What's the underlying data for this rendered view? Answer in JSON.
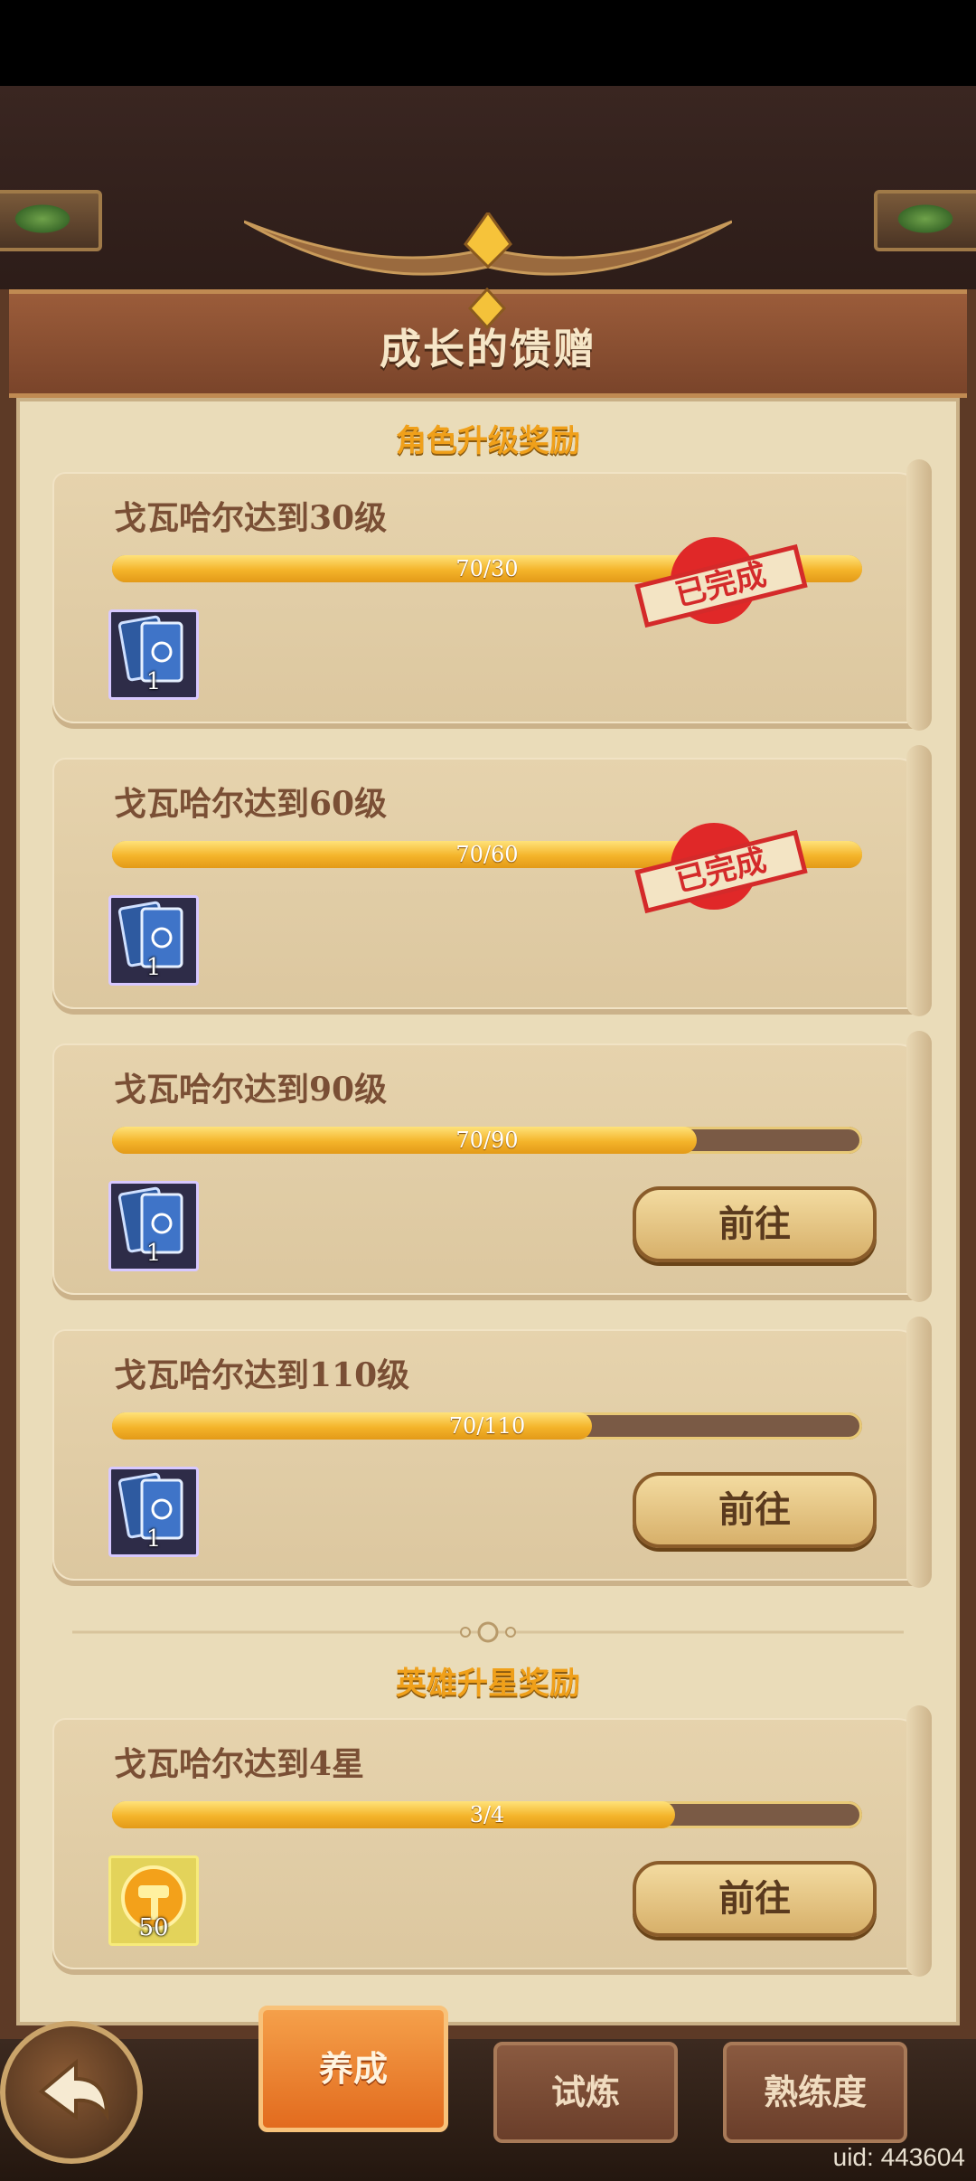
{
  "header": {
    "title": "成长的馈赠"
  },
  "sections": [
    {
      "title": "角色升级奖励",
      "tasks": [
        {
          "label": "戈瓦哈尔达到30级",
          "progress_text": "70/30",
          "progress": 1.0,
          "reward": {
            "icon": "card-pack-icon",
            "qty": "1"
          },
          "status": "已完成"
        },
        {
          "label": "戈瓦哈尔达到60级",
          "progress_text": "70/60",
          "progress": 1.0,
          "reward": {
            "icon": "card-pack-icon",
            "qty": "1"
          },
          "status": "已完成"
        },
        {
          "label": "戈瓦哈尔达到90级",
          "progress_text": "70/90",
          "progress": 0.78,
          "reward": {
            "icon": "card-pack-icon",
            "qty": "1"
          },
          "button": "前往"
        },
        {
          "label": "戈瓦哈尔达到110级",
          "progress_text": "70/110",
          "progress": 0.64,
          "reward": {
            "icon": "card-pack-icon",
            "qty": "1"
          },
          "button": "前往"
        }
      ]
    },
    {
      "title": "英雄升星奖励",
      "tasks": [
        {
          "label": "戈瓦哈尔达到4星",
          "progress_text": "3/4",
          "progress": 0.75,
          "reward": {
            "icon": "gold-hammer-icon",
            "qty": "50"
          },
          "button": "前往"
        }
      ]
    }
  ],
  "tabs": [
    {
      "label": "养成",
      "active": true
    },
    {
      "label": "试炼",
      "active": false
    },
    {
      "label": "熟练度",
      "active": false
    }
  ],
  "footer": {
    "uid": "uid: 443604"
  },
  "colors": {
    "accent": "#f0a01a",
    "stamp": "#d42a2a",
    "tab_active": "#e8782a"
  }
}
